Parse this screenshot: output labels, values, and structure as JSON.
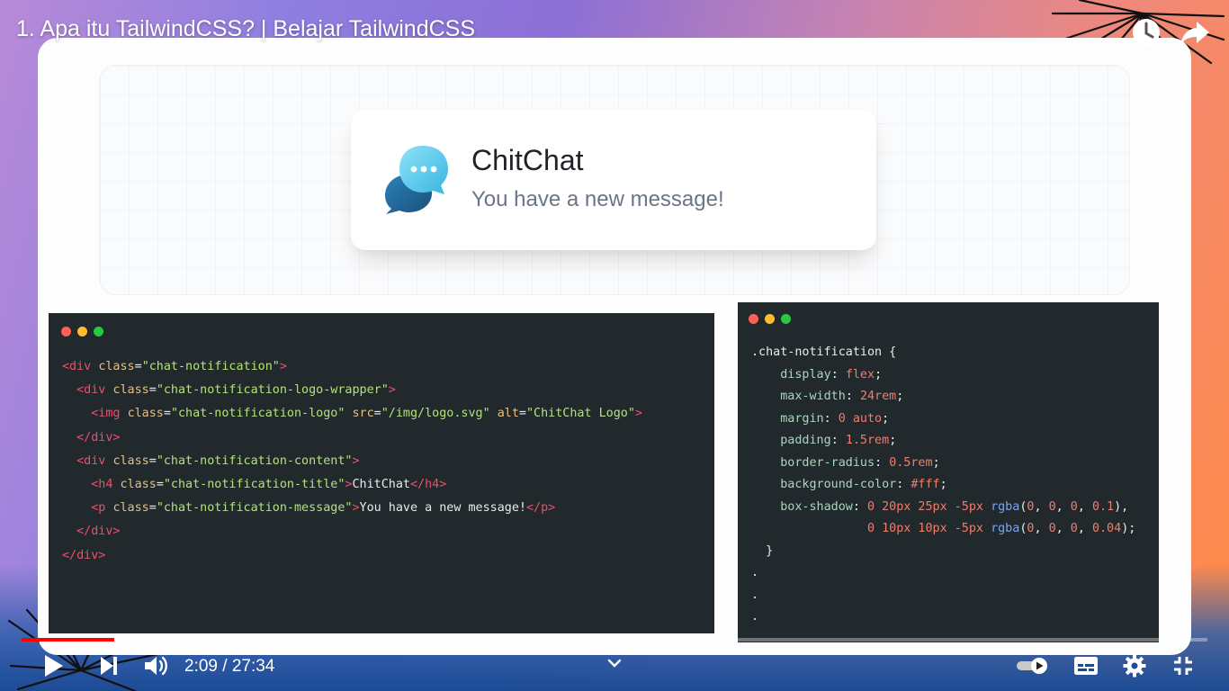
{
  "video": {
    "title": "1. Apa itu TailwindCSS? | Belajar TailwindCSS",
    "current_time": "2:09",
    "duration": "27:34",
    "time_separator": " / ",
    "progress_fraction": 0.078
  },
  "preview_card": {
    "title": "ChitChat",
    "message": "You have a new message!",
    "logo_icon": "chat-bubbles-logo"
  },
  "html_editor": {
    "window_dots": [
      "#ff5f57",
      "#febc2e",
      "#28c840"
    ],
    "lines": [
      [
        [
          "tg",
          "<div "
        ],
        [
          "at",
          "class"
        ],
        [
          "eq",
          "="
        ],
        [
          "st",
          "\"chat-notification\""
        ],
        [
          "tg",
          ">"
        ]
      ],
      [
        [
          "sl",
          "  "
        ],
        [
          "tg",
          "<div "
        ],
        [
          "at",
          "class"
        ],
        [
          "eq",
          "="
        ],
        [
          "st",
          "\"chat-notification-logo-wrapper\""
        ],
        [
          "tg",
          ">"
        ]
      ],
      [
        [
          "sl",
          "    "
        ],
        [
          "tg",
          "<img "
        ],
        [
          "at",
          "class"
        ],
        [
          "eq",
          "="
        ],
        [
          "st",
          "\"chat-notification-logo\""
        ],
        [
          "sl",
          " "
        ],
        [
          "at",
          "src"
        ],
        [
          "eq",
          "="
        ],
        [
          "st",
          "\"/img/logo.svg\""
        ],
        [
          "sl",
          " "
        ],
        [
          "at",
          "alt"
        ],
        [
          "eq",
          "="
        ],
        [
          "st",
          "\"ChitChat Logo\""
        ],
        [
          "tg",
          ">"
        ]
      ],
      [
        [
          "sl",
          "  "
        ],
        [
          "tg",
          "</div>"
        ]
      ],
      [
        [
          "sl",
          "  "
        ],
        [
          "tg",
          "<div "
        ],
        [
          "at",
          "class"
        ],
        [
          "eq",
          "="
        ],
        [
          "st",
          "\"chat-notification-content\""
        ],
        [
          "tg",
          ">"
        ]
      ],
      [
        [
          "sl",
          "    "
        ],
        [
          "tg",
          "<h4 "
        ],
        [
          "at",
          "class"
        ],
        [
          "eq",
          "="
        ],
        [
          "st",
          "\"chat-notification-title\""
        ],
        [
          "tg",
          ">"
        ],
        [
          "sl",
          "ChitChat"
        ],
        [
          "tg",
          "</h4>"
        ]
      ],
      [
        [
          "sl",
          "    "
        ],
        [
          "tg",
          "<p "
        ],
        [
          "at",
          "class"
        ],
        [
          "eq",
          "="
        ],
        [
          "st",
          "\"chat-notification-message\""
        ],
        [
          "tg",
          ">"
        ],
        [
          "sl",
          "You have a new message!"
        ],
        [
          "tg",
          "</p>"
        ]
      ],
      [
        [
          "sl",
          "  "
        ],
        [
          "tg",
          "</div>"
        ]
      ],
      [
        [
          "tg",
          "</div>"
        ]
      ]
    ]
  },
  "css_editor": {
    "window_dots": [
      "#ff5f57",
      "#febc2e",
      "#28c840"
    ],
    "lines": [
      [
        [
          "sl",
          ".chat-notification {"
        ]
      ],
      [
        [
          "sl",
          "    "
        ],
        [
          "pr",
          "display"
        ],
        [
          "sl",
          ": "
        ],
        [
          "vl",
          "flex"
        ],
        [
          "sl",
          ";"
        ]
      ],
      [
        [
          "sl",
          "    "
        ],
        [
          "pr",
          "max-width"
        ],
        [
          "sl",
          ": "
        ],
        [
          "vl",
          "24rem"
        ],
        [
          "sl",
          ";"
        ]
      ],
      [
        [
          "sl",
          "    "
        ],
        [
          "pr",
          "margin"
        ],
        [
          "sl",
          ": "
        ],
        [
          "vl",
          "0 auto"
        ],
        [
          "sl",
          ";"
        ]
      ],
      [
        [
          "sl",
          "    "
        ],
        [
          "pr",
          "padding"
        ],
        [
          "sl",
          ": "
        ],
        [
          "vl",
          "1.5rem"
        ],
        [
          "sl",
          ";"
        ]
      ],
      [
        [
          "sl",
          "    "
        ],
        [
          "pr",
          "border-radius"
        ],
        [
          "sl",
          ": "
        ],
        [
          "vl",
          "0.5rem"
        ],
        [
          "sl",
          ";"
        ]
      ],
      [
        [
          "sl",
          "    "
        ],
        [
          "pr",
          "background-color"
        ],
        [
          "sl",
          ": "
        ],
        [
          "vl",
          "#fff"
        ],
        [
          "sl",
          ";"
        ]
      ],
      [
        [
          "sl",
          "    "
        ],
        [
          "pr",
          "box-shadow"
        ],
        [
          "sl",
          ": "
        ],
        [
          "vl",
          "0 20px 25px -5px "
        ],
        [
          "fn",
          "rgba"
        ],
        [
          "sl",
          "("
        ],
        [
          "vl",
          "0"
        ],
        [
          "sl",
          ", "
        ],
        [
          "vl",
          "0"
        ],
        [
          "sl",
          ", "
        ],
        [
          "vl",
          "0"
        ],
        [
          "sl",
          ", "
        ],
        [
          "vl",
          "0.1"
        ],
        [
          "sl",
          "),"
        ]
      ],
      [
        [
          "sl",
          "                "
        ],
        [
          "vl",
          "0 10px 10px -5px "
        ],
        [
          "fn",
          "rgba"
        ],
        [
          "sl",
          "("
        ],
        [
          "vl",
          "0"
        ],
        [
          "sl",
          ", "
        ],
        [
          "vl",
          "0"
        ],
        [
          "sl",
          ", "
        ],
        [
          "vl",
          "0"
        ],
        [
          "sl",
          ", "
        ],
        [
          "vl",
          "0.04"
        ],
        [
          "sl",
          ");"
        ]
      ],
      [
        [
          "sl",
          "  }"
        ]
      ],
      [
        [
          "sl",
          "."
        ]
      ],
      [
        [
          "sl",
          "."
        ]
      ],
      [
        [
          "sl",
          "."
        ]
      ]
    ]
  },
  "controls": {
    "play_icon": "play-icon",
    "next_icon": "next-icon",
    "volume_icon": "volume-icon",
    "chevron_icon": "chevron-down-icon",
    "autoplay_icon": "autoplay-toggle-icon",
    "subtitles_icon": "subtitles-icon",
    "settings_icon": "gear-icon",
    "exit_fullscreen_icon": "exit-fullscreen-icon",
    "watch_later_icon": "clock-icon",
    "share_icon": "share-icon"
  }
}
